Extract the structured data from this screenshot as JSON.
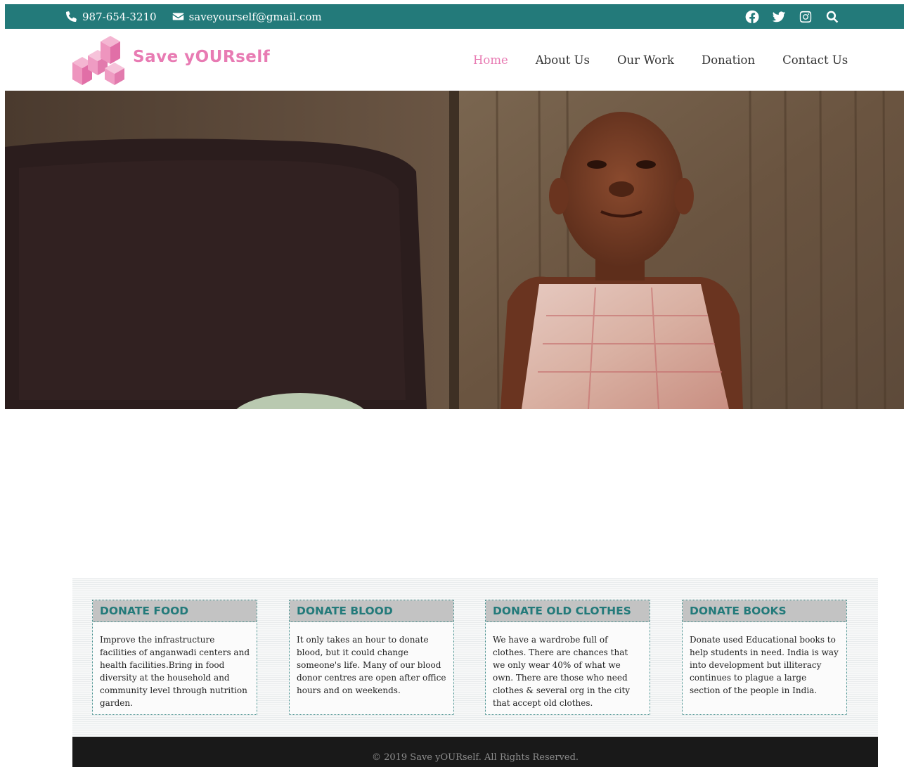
{
  "topbar": {
    "phone": "987-654-3210",
    "email": "saveyourself@gmail.com",
    "phone_icon": "phone-icon",
    "email_icon": "envelope-icon",
    "social": [
      "facebook-icon",
      "twitter-icon",
      "instagram-icon",
      "search-icon"
    ],
    "background": "#237a7a"
  },
  "header": {
    "brand": "Save yOURself",
    "brand_color": "#e87bb3",
    "nav": [
      {
        "label": "Home",
        "active": true
      },
      {
        "label": "About Us",
        "active": false
      },
      {
        "label": "Our Work",
        "active": false
      },
      {
        "label": "Donation",
        "active": false
      },
      {
        "label": "Contact Us",
        "active": false
      }
    ]
  },
  "hero": {
    "image": "photo of a smiling young girl in a plaid dress sitting against a rusty corrugated metal wall"
  },
  "donate": {
    "cards": [
      {
        "title": "DONATE FOOD",
        "text": "Improve the infrastructure facilities of anganwadi centers and health facilities.Bring in food diversity at the household and community level through nutrition garden."
      },
      {
        "title": "DONATE BLOOD",
        "text": "It only takes an hour to donate blood, but it could change someone's life. Many of our blood donor centres are open after office hours and on weekends."
      },
      {
        "title": "DONATE OLD CLOTHES",
        "text": "We have a wardrobe full of clothes. There are chances that we only wear 40% of what we own. There are those who need clothes & several org in the city that accept old clothes."
      },
      {
        "title": "DONATE BOOKS",
        "text": "Donate used Educational books to help students in need. India is way into development but illiteracy continues to plague a large section of the people in India."
      }
    ],
    "accent": "#237a7a"
  },
  "footer": {
    "copyright": "© 2019 Save yOURself. All Rights Reserved."
  }
}
